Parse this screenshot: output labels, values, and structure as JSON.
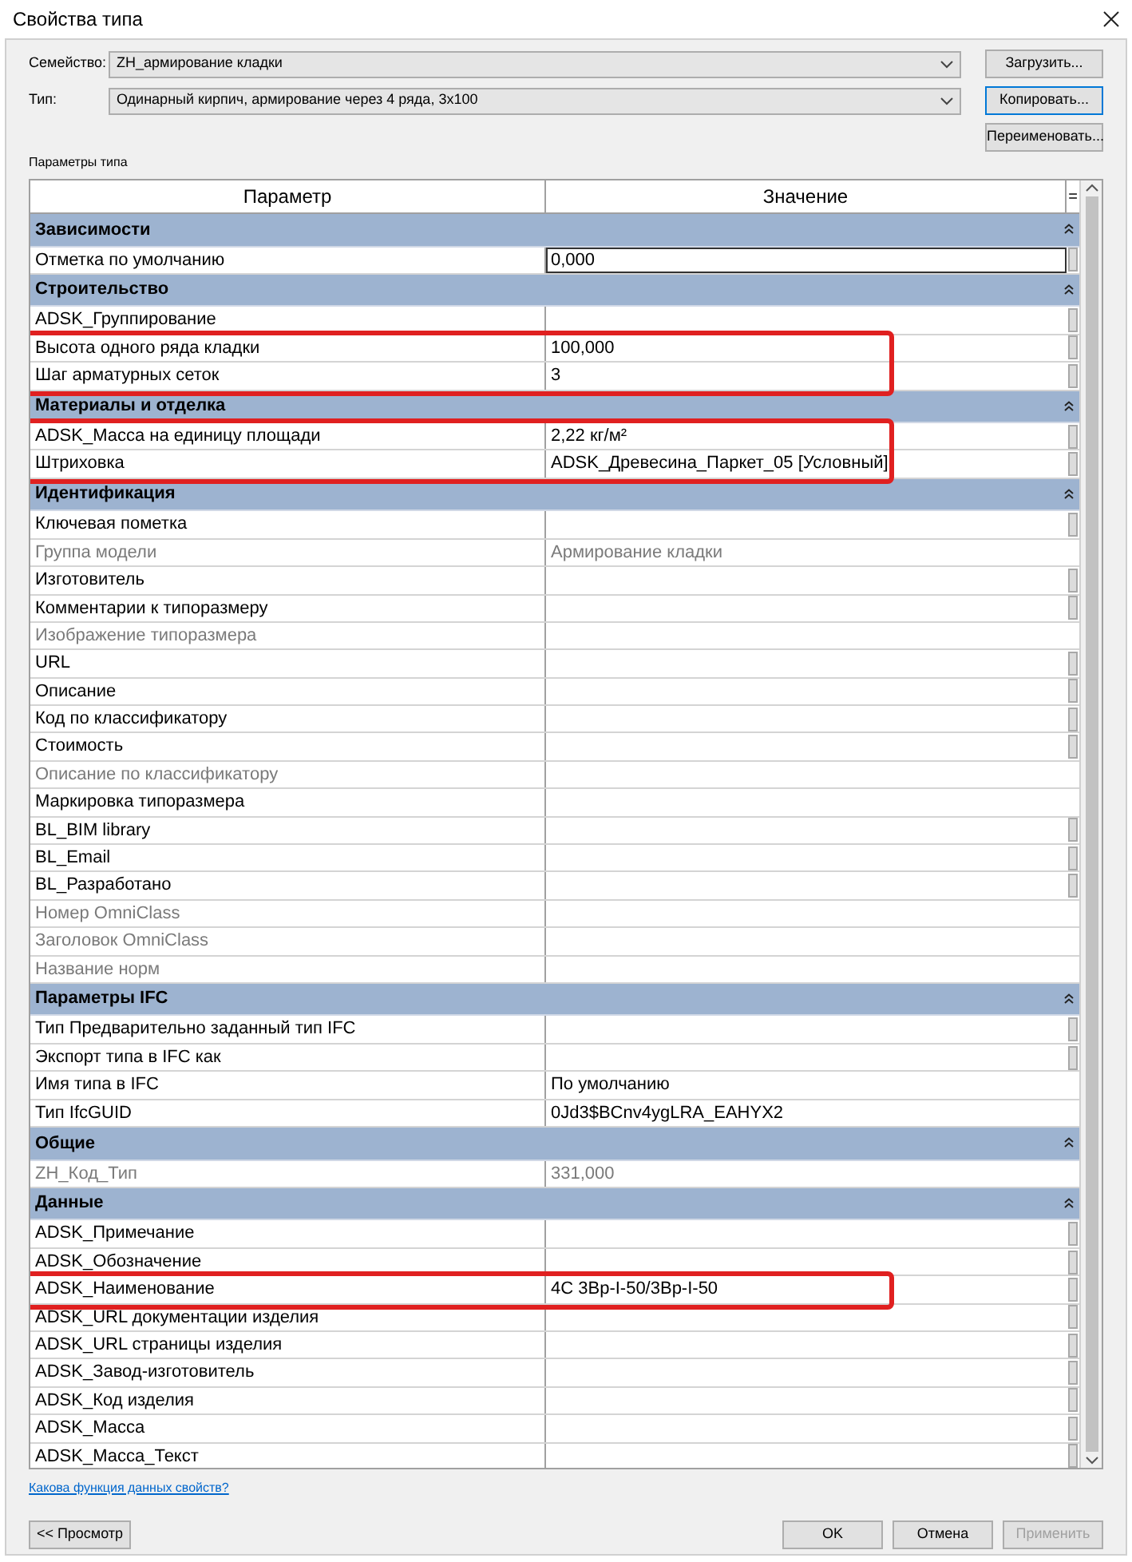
{
  "window": {
    "title": "Свойства типа"
  },
  "family": {
    "label": "Семейство:",
    "value": "ZH_армирование кладки",
    "button": "Загрузить..."
  },
  "type": {
    "label": "Тип:",
    "value": "Одинарный кирпич, армирование через 4 ряда, 3x100",
    "buttons": [
      {
        "label": "Копировать...",
        "focused": true
      },
      {
        "label": "Переименовать...",
        "focused": false
      }
    ]
  },
  "section_label": "Параметры типа",
  "table": {
    "columns": [
      "Параметр",
      "Значение",
      "="
    ],
    "groups": [
      {
        "title": "Зависимости",
        "expanded": true,
        "rows": [
          {
            "name": "Отметка по умолчанию",
            "value": "0,000",
            "disabled": false,
            "editing": true,
            "param_button": true,
            "highlighted": false
          }
        ]
      },
      {
        "title": "Строительство",
        "expanded": true,
        "rows": [
          {
            "name": "ADSK_Группирование",
            "value": "",
            "disabled": false,
            "editing": false,
            "param_button": true,
            "highlighted": false
          },
          {
            "name": "Высота одного ряда кладки",
            "value": "100,000",
            "disabled": false,
            "editing": false,
            "param_button": true,
            "highlighted": true
          },
          {
            "name": "Шаг арматурных сеток",
            "value": "3",
            "disabled": false,
            "editing": false,
            "param_button": true,
            "highlighted": true
          }
        ]
      },
      {
        "title": "Материалы и отделка",
        "expanded": true,
        "rows": [
          {
            "name": "ADSK_Масса на единицу площади",
            "value": "2,22 кг/м²",
            "disabled": false,
            "editing": false,
            "param_button": true,
            "highlighted": true
          },
          {
            "name": "Штриховка",
            "value": "ADSK_Древесина_Паркет_05 [Условный]",
            "disabled": false,
            "editing": false,
            "param_button": true,
            "highlighted": true
          }
        ]
      },
      {
        "title": "Идентификация",
        "expanded": true,
        "rows": [
          {
            "name": "Ключевая пометка",
            "value": "",
            "disabled": false,
            "editing": false,
            "param_button": true,
            "highlighted": false
          },
          {
            "name": "Группа модели",
            "value": "Армирование кладки",
            "disabled": true,
            "editing": false,
            "param_button": false,
            "highlighted": false
          },
          {
            "name": "Изготовитель",
            "value": "",
            "disabled": false,
            "editing": false,
            "param_button": true,
            "highlighted": false
          },
          {
            "name": "Комментарии к типоразмеру",
            "value": "",
            "disabled": false,
            "editing": false,
            "param_button": true,
            "highlighted": false
          },
          {
            "name": "Изображение типоразмера",
            "value": "",
            "disabled": true,
            "editing": false,
            "param_button": false,
            "highlighted": false
          },
          {
            "name": "URL",
            "value": "",
            "disabled": false,
            "editing": false,
            "param_button": true,
            "highlighted": false
          },
          {
            "name": "Описание",
            "value": "",
            "disabled": false,
            "editing": false,
            "param_button": true,
            "highlighted": false
          },
          {
            "name": "Код по классификатору",
            "value": "",
            "disabled": false,
            "editing": false,
            "param_button": true,
            "highlighted": false
          },
          {
            "name": "Стоимость",
            "value": "",
            "disabled": false,
            "editing": false,
            "param_button": true,
            "highlighted": false
          },
          {
            "name": "Описание по классификатору",
            "value": "",
            "disabled": true,
            "editing": false,
            "param_button": false,
            "highlighted": false
          },
          {
            "name": "Маркировка типоразмера",
            "value": "",
            "disabled": false,
            "editing": false,
            "param_button": false,
            "highlighted": false
          },
          {
            "name": "BL_BIM library",
            "value": "",
            "disabled": false,
            "editing": false,
            "param_button": true,
            "highlighted": false
          },
          {
            "name": "BL_Email",
            "value": "",
            "disabled": false,
            "editing": false,
            "param_button": true,
            "highlighted": false
          },
          {
            "name": "BL_Разработано",
            "value": "",
            "disabled": false,
            "editing": false,
            "param_button": true,
            "highlighted": false
          },
          {
            "name": "Номер OmniClass",
            "value": "",
            "disabled": true,
            "editing": false,
            "param_button": false,
            "highlighted": false
          },
          {
            "name": "Заголовок OmniClass",
            "value": "",
            "disabled": true,
            "editing": false,
            "param_button": false,
            "highlighted": false
          },
          {
            "name": "Название норм",
            "value": "",
            "disabled": true,
            "editing": false,
            "param_button": false,
            "highlighted": false
          }
        ]
      },
      {
        "title": "Параметры IFC",
        "expanded": true,
        "rows": [
          {
            "name": "Тип Предварительно заданный тип IFC",
            "value": "",
            "disabled": false,
            "editing": false,
            "param_button": true,
            "highlighted": false
          },
          {
            "name": "Экспорт типа в IFC как",
            "value": "",
            "disabled": false,
            "editing": false,
            "param_button": true,
            "highlighted": false
          },
          {
            "name": "Имя типа в IFC",
            "value": "По умолчанию",
            "disabled": false,
            "editing": false,
            "param_button": false,
            "highlighted": false
          },
          {
            "name": "Тип IfcGUID",
            "value": "0Jd3$BCnv4ygLRA_EAHYX2",
            "disabled": false,
            "editing": false,
            "param_button": false,
            "highlighted": false
          }
        ]
      },
      {
        "title": "Общие",
        "expanded": true,
        "rows": [
          {
            "name": "ZH_Код_Тип",
            "value": "331,000",
            "disabled": true,
            "editing": false,
            "param_button": false,
            "highlighted": false
          }
        ]
      },
      {
        "title": "Данные",
        "expanded": true,
        "rows": [
          {
            "name": "ADSK_Примечание",
            "value": "",
            "disabled": false,
            "editing": false,
            "param_button": true,
            "highlighted": false
          },
          {
            "name": "ADSK_Обозначение",
            "value": "",
            "disabled": false,
            "editing": false,
            "param_button": true,
            "highlighted": false
          },
          {
            "name": "ADSK_Наименование",
            "value": "4C 3Вр-I-50/3Вр-I-50",
            "disabled": false,
            "editing": false,
            "param_button": true,
            "highlighted": true
          },
          {
            "name": "ADSK_URL документации изделия",
            "value": "",
            "disabled": false,
            "editing": false,
            "param_button": true,
            "highlighted": false
          },
          {
            "name": "ADSK_URL страницы изделия",
            "value": "",
            "disabled": false,
            "editing": false,
            "param_button": true,
            "highlighted": false
          },
          {
            "name": "ADSK_Завод-изготовитель",
            "value": "",
            "disabled": false,
            "editing": false,
            "param_button": true,
            "highlighted": false
          },
          {
            "name": "ADSK_Код изделия",
            "value": "",
            "disabled": false,
            "editing": false,
            "param_button": true,
            "highlighted": false
          },
          {
            "name": "ADSK_Масса",
            "value": "",
            "disabled": false,
            "editing": false,
            "param_button": true,
            "highlighted": false
          },
          {
            "name": "ADSK_Масса_Текст",
            "value": "",
            "disabled": false,
            "editing": false,
            "param_button": true,
            "highlighted": false
          }
        ]
      }
    ]
  },
  "help_link": "Какова функция данных свойств?",
  "preview_button": "<< Просмотр",
  "buttons": [
    {
      "label": "OK",
      "disabled": false
    },
    {
      "label": "Отмена",
      "disabled": false
    },
    {
      "label": "Применить",
      "disabled": true
    }
  ]
}
